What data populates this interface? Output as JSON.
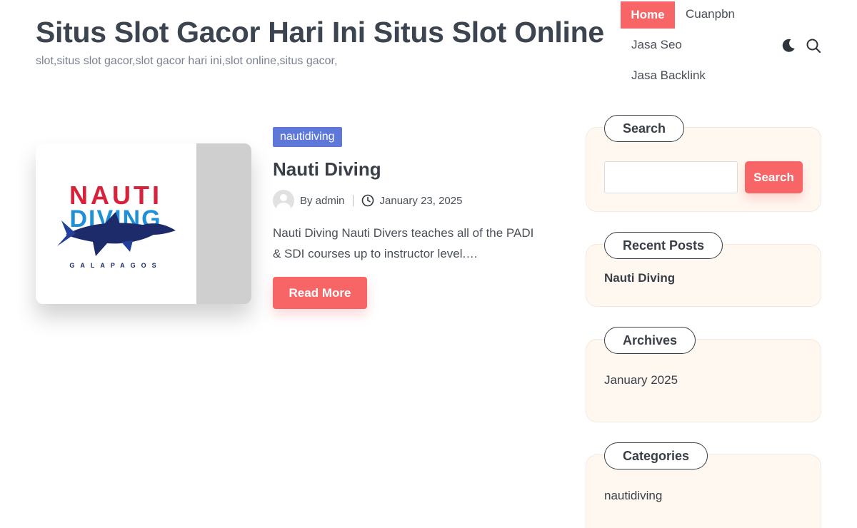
{
  "header": {
    "site_title": "Situs Slot Gacor Hari Ini Situs Slot Online",
    "tagline": "slot,situs slot gacor,slot gacor hari ini,slot online,situs gacor,"
  },
  "nav": {
    "home": "Home",
    "cuanpbn": "Cuanpbn",
    "jasa_seo": "Jasa Seo",
    "jasa_backlink": "Jasa Backlink"
  },
  "icons": {
    "theme_toggle": "moon-icon",
    "search": "search-icon",
    "author_avatar": "user-avatar-icon",
    "date": "clock-icon"
  },
  "post": {
    "category": "nautidiving",
    "title": "Nauti Diving",
    "author": "By admin",
    "date": "January 23, 2025",
    "excerpt": "Nauti Diving Nauti Divers teaches all of the PADI & SDI courses up to instructor level.…",
    "read_more": "Read More",
    "logo": {
      "line1": "NAUTI",
      "line2": "DIVING",
      "line3": "GALAPAGOS"
    }
  },
  "sidebar": {
    "search": {
      "title": "Search",
      "placeholder": "",
      "button": "Search"
    },
    "recent": {
      "title": "Recent Posts",
      "items": [
        "Nauti Diving"
      ]
    },
    "archives": {
      "title": "Archives",
      "items": [
        "January 2025"
      ]
    },
    "categories": {
      "title": "Categories",
      "items": [
        "nautidiving"
      ]
    }
  },
  "colors": {
    "accent": "#f76566",
    "category_badge": "#5d78d9",
    "widget_bg": "#fff8f1",
    "logo_red": "#d8213a",
    "logo_blue": "#1f8fd6",
    "logo_navy": "#1d2b6b"
  }
}
